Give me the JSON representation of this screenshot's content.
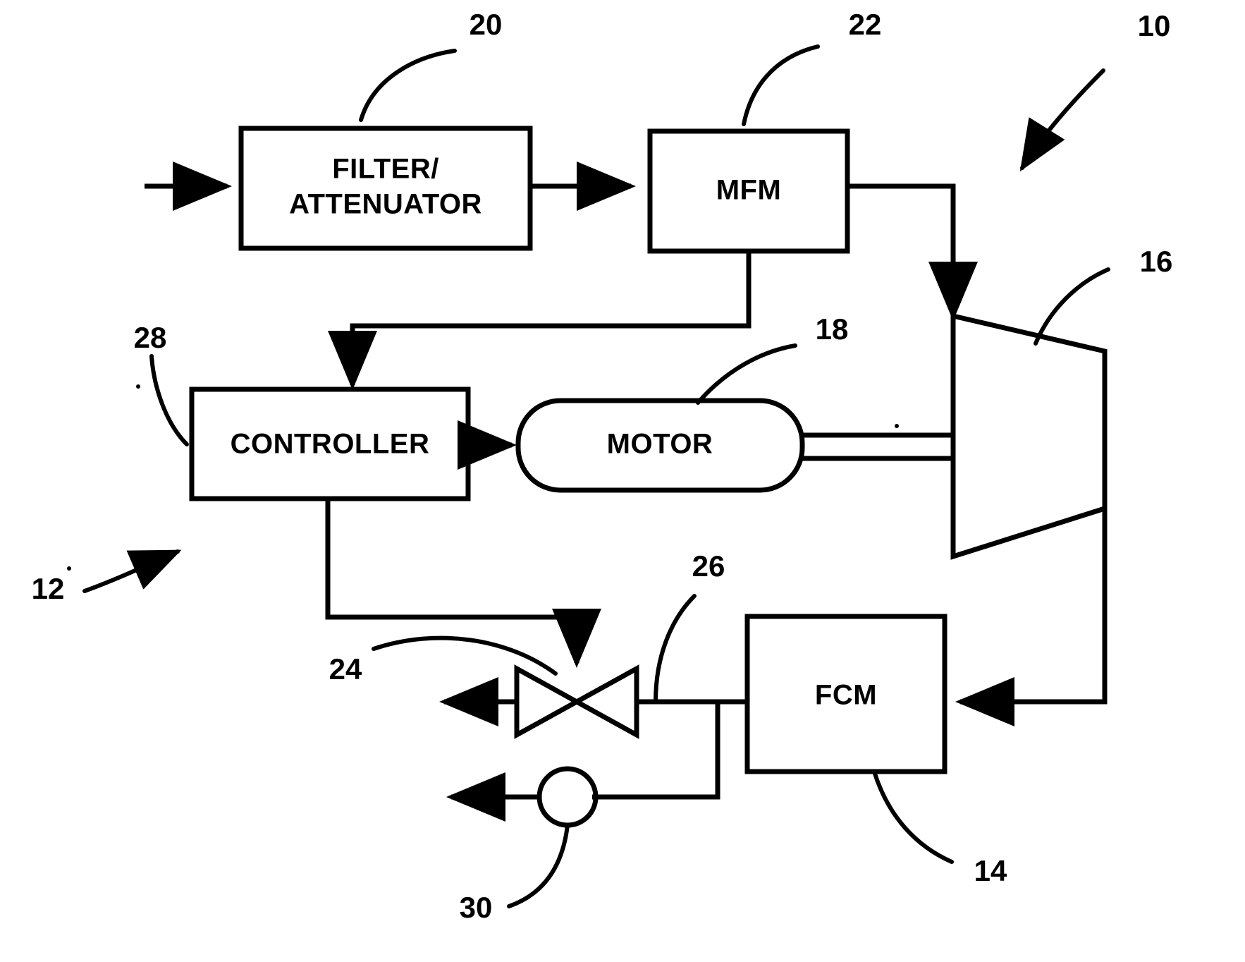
{
  "figure": {
    "title": "Gas turbine fuel control system block diagram",
    "background_color": "#ffffff",
    "line_color": "#000000"
  },
  "blocks": {
    "filter_attenuator": {
      "label_line1": "FILTER/",
      "label_line2": "ATTENUATOR",
      "shape": "rectangle"
    },
    "mfm": {
      "label": "MFM",
      "shape": "rectangle"
    },
    "controller": {
      "label": "CONTROLLER",
      "shape": "rectangle"
    },
    "motor": {
      "label": "MOTOR",
      "shape": "rounded-rectangle"
    },
    "fcm": {
      "label": "FCM",
      "shape": "rectangle"
    },
    "turbine": {
      "label": "",
      "shape": "trapezoid"
    },
    "valve": {
      "label": "",
      "shape": "bowtie-valve"
    },
    "orifice": {
      "label": "",
      "shape": "circle"
    }
  },
  "reference_numerals": [
    {
      "id": "ref-20",
      "text": "20",
      "target": "filter-attenuator-block"
    },
    {
      "id": "ref-22",
      "text": "22",
      "target": "mfm-block"
    },
    {
      "id": "ref-10",
      "text": "10",
      "target": "overall-system"
    },
    {
      "id": "ref-16",
      "text": "16",
      "target": "turbine"
    },
    {
      "id": "ref-18",
      "text": "18",
      "target": "motor-shaft"
    },
    {
      "id": "ref-28",
      "text": "28",
      "target": "controller-block"
    },
    {
      "id": "ref-12",
      "text": "12",
      "target": "control-subsystem"
    },
    {
      "id": "ref-26",
      "text": "26",
      "target": "fuel-line"
    },
    {
      "id": "ref-24",
      "text": "24",
      "target": "valve"
    },
    {
      "id": "ref-30",
      "text": "30",
      "target": "orifice"
    },
    {
      "id": "ref-14",
      "text": "14",
      "target": "fcm-block"
    }
  ],
  "connections": [
    {
      "from": "inlet",
      "to": "filter_attenuator",
      "arrow": true
    },
    {
      "from": "filter_attenuator",
      "to": "mfm",
      "arrow": true
    },
    {
      "from": "mfm",
      "to": "controller",
      "arrow": true
    },
    {
      "from": "mfm",
      "to": "turbine",
      "arrow": true
    },
    {
      "from": "controller",
      "to": "motor",
      "arrow": true
    },
    {
      "from": "motor",
      "to": "turbine",
      "arrow": false
    },
    {
      "from": "controller",
      "to": "valve",
      "arrow": true
    },
    {
      "from": "turbine",
      "to": "fcm",
      "arrow": true
    },
    {
      "from": "fcm",
      "to": "valve",
      "arrow": false
    },
    {
      "from": "valve",
      "to": "outlet",
      "arrow": true
    },
    {
      "from": "fcm",
      "to": "orifice",
      "arrow": false
    },
    {
      "from": "orifice",
      "to": "outlet",
      "arrow": true
    }
  ]
}
